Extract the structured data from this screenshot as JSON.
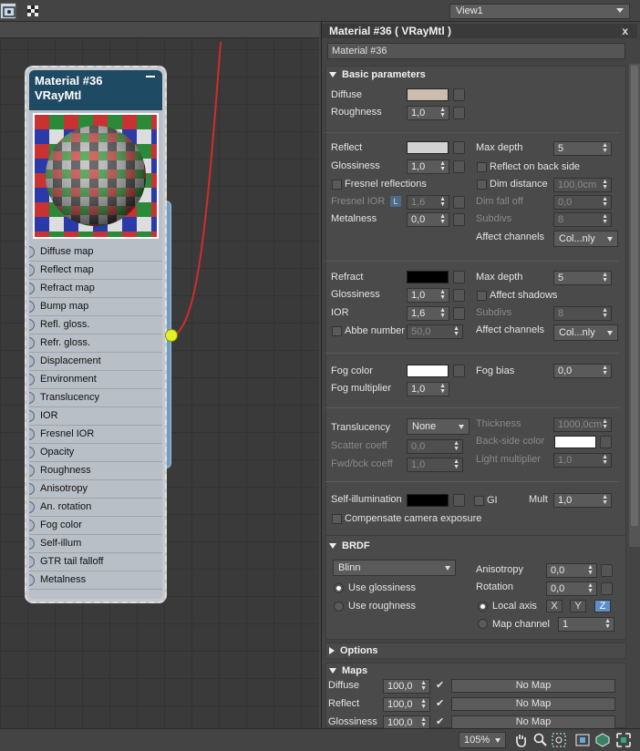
{
  "view": {
    "selected": "View1"
  },
  "node": {
    "title_line1": "Material #36",
    "title_line2": "VRayMtl",
    "slots": [
      "Diffuse map",
      "Reflect map",
      "Refract map",
      "Bump map",
      "Refl. gloss.",
      "Refr. gloss.",
      "Displacement",
      "Environment",
      "Translucency",
      "IOR",
      "Fresnel IOR",
      "Opacity",
      "Roughness",
      "Anisotropy",
      "An. rotation",
      "Fog color",
      "Self-illum",
      "GTR tail falloff",
      "Metalness"
    ]
  },
  "panel": {
    "title": "Material #36  ( VRayMtl )",
    "close": "x",
    "material_name": "Material #36"
  },
  "basic": {
    "header": "Basic parameters",
    "diffuse_label": "Diffuse",
    "roughness_label": "Roughness",
    "roughness": "1,0",
    "reflect_label": "Reflect",
    "glossiness_label": "Glossiness",
    "glossiness": "1,0",
    "fresnel_label": "Fresnel reflections",
    "fresnel_ior_label": "Fresnel IOR",
    "fresnel_ior_lock": "L",
    "fresnel_ior": "1,6",
    "metalness_label": "Metalness",
    "metalness": "0,0",
    "max_depth_label": "Max depth",
    "max_depth": "5",
    "reflect_back_label": "Reflect on back side",
    "dim_distance_label": "Dim distance",
    "dim_distance": "100,0cm",
    "dim_falloff_label": "Dim fall off",
    "dim_falloff": "0,0",
    "subdivs_label": "Subdivs",
    "subdivs": "8",
    "affect_channels_label": "Affect channels",
    "affect_channels": "Col...nly",
    "refract_label": "Refract",
    "refr_glossiness_label": "Glossiness",
    "refr_glossiness": "1,0",
    "ior_label": "IOR",
    "ior": "1,6",
    "abbe_label": "Abbe number",
    "abbe": "50,0",
    "refr_max_depth_label": "Max depth",
    "refr_max_depth": "5",
    "affect_shadows_label": "Affect shadows",
    "refr_subdivs_label": "Subdivs",
    "refr_subdivs": "8",
    "refr_affect_channels_label": "Affect channels",
    "refr_affect_channels": "Col...nly",
    "fog_color_label": "Fog color",
    "fog_multiplier_label": "Fog multiplier",
    "fog_multiplier": "1,0",
    "fog_bias_label": "Fog bias",
    "fog_bias": "0,0",
    "translucency_label": "Translucency",
    "translucency": "None",
    "scatter_label": "Scatter coeff",
    "scatter": "0,0",
    "fwd_label": "Fwd/bck coeff",
    "fwd": "1,0",
    "thickness_label": "Thickness",
    "thickness": "1000,0cm",
    "backside_label": "Back-side color",
    "light_mult_label": "Light multiplier",
    "light_mult": "1,0",
    "selfillum_label": "Self-illumination",
    "gi_label": "GI",
    "mult_label": "Mult",
    "mult": "1,0",
    "compensate_label": "Compensate camera exposure"
  },
  "brdf": {
    "header": "BRDF",
    "type": "Blinn",
    "use_glossiness": "Use glossiness",
    "use_roughness": "Use roughness",
    "anisotropy_label": "Anisotropy",
    "anisotropy": "0,0",
    "rotation_label": "Rotation",
    "rotation": "0,0",
    "local_axis_label": "Local axis",
    "axis_x": "X",
    "axis_y": "Y",
    "axis_z": "Z",
    "map_channel_label": "Map channel",
    "map_channel": "1"
  },
  "options": {
    "header": "Options"
  },
  "maps": {
    "header": "Maps",
    "rows": [
      {
        "label": "Diffuse",
        "value": "100,0",
        "map": "No Map"
      },
      {
        "label": "Reflect",
        "value": "100,0",
        "map": "No Map"
      },
      {
        "label": "Glossiness",
        "value": "100,0",
        "map": "No Map"
      }
    ]
  },
  "status": {
    "zoom": "105%"
  },
  "colors": {
    "diffuse": "#cbbcae",
    "reflect": "#d2d2d2",
    "refract": "#000000",
    "fog": "#ffffff",
    "backside": "#ffffff",
    "selfillum": "#000000",
    "wire": "#d22c2c",
    "output": "#e3f12a"
  }
}
